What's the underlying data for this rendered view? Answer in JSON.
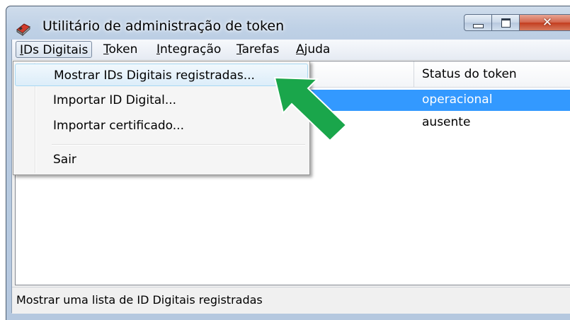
{
  "window": {
    "title": "Utilitário de administração de token",
    "close_symbol": "✕"
  },
  "menubar": {
    "items": [
      {
        "underline": "I",
        "rest": "Ds Digitais"
      },
      {
        "underline": "T",
        "rest": "oken"
      },
      {
        "underline": "I",
        "rest": "ntegração"
      },
      {
        "underline": "T",
        "rest": "arefas"
      },
      {
        "underline": "A",
        "rest": "juda"
      }
    ]
  },
  "dropdown": {
    "items": [
      {
        "label": "Mostrar IDs Digitais registradas..."
      },
      {
        "label": "Importar ID Digital..."
      },
      {
        "label": "Importar certificado..."
      },
      {
        "label": "Sair"
      }
    ]
  },
  "list": {
    "column_header": "Status do token",
    "rows": [
      {
        "status": "operacional",
        "selected": true
      },
      {
        "status": "ausente",
        "selected": false
      }
    ]
  },
  "statusbar": {
    "text": "Mostrar uma lista de ID Digitais registradas"
  },
  "colors": {
    "selection": "#3399ff",
    "arrow": "#1aa64b"
  },
  "icons": {
    "app": "token-icon",
    "annotation": "green-arrow-icon"
  }
}
